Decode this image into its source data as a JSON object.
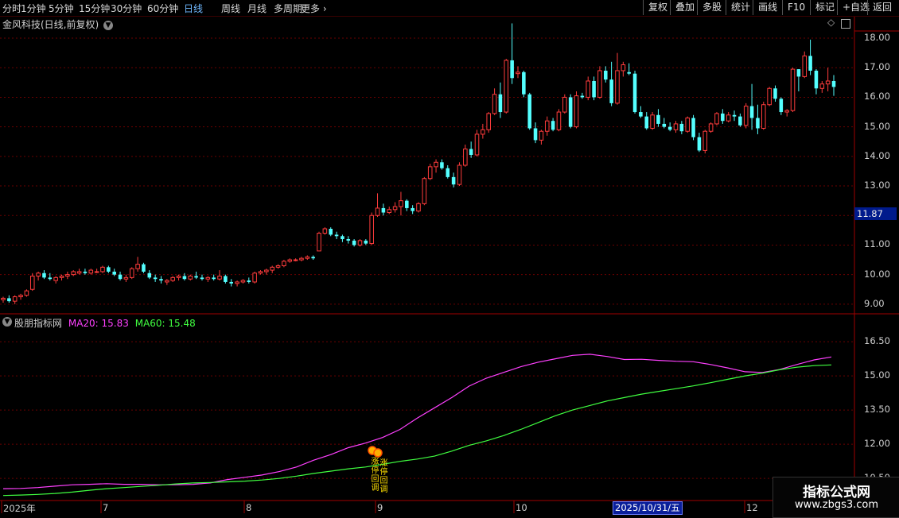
{
  "toolbar": {
    "left_items": [
      "分时",
      "1分钟",
      "5分钟",
      "15分钟",
      "30分钟",
      "60分钟",
      "日线",
      "周线",
      "月线",
      "多周期",
      "更多"
    ],
    "active_item": "日线",
    "right_items": [
      "复权",
      "叠加",
      "多股",
      "统计",
      "画线",
      "F10",
      "+自选",
      "返回"
    ],
    "right_extra": "标记"
  },
  "stock": {
    "title": "金风科技(日线,前复权)"
  },
  "price_axis": {
    "ticks": [
      "18.00",
      "17.00",
      "16.00",
      "15.00",
      "14.00",
      "13.00",
      "12.00",
      "11.00",
      "10.00",
      "9.00"
    ],
    "current_price": "11.87"
  },
  "indicator": {
    "name": "股朋指标网",
    "ma20_label": "MA20: 15.83",
    "ma60_label": "MA60: 15.48",
    "axis_ticks": [
      "16.50",
      "15.00",
      "13.50",
      "12.00",
      "10.50"
    ],
    "signal_text_left": "涨停回调",
    "signal_text_right": "涨停回调"
  },
  "date_axis": {
    "labels": [
      "2025年",
      "7",
      "8",
      "9",
      "10",
      "12"
    ],
    "cursor_date": "2025/10/31/五"
  },
  "watermark": {
    "title": "指标公式网",
    "url": "www.zbgs3.com"
  },
  "colors": {
    "up": "#ff3c3c",
    "down": "#54ffff",
    "ma20": "#ff40ff",
    "ma60": "#40ff40",
    "grid": "#6a0000",
    "signal": "#ffe000"
  },
  "chart_data": {
    "type": "candlestick",
    "price_unit": "CNY",
    "candles": [
      [
        9.15,
        9.25,
        9.05,
        9.2
      ],
      [
        9.2,
        9.3,
        9.05,
        9.1
      ],
      [
        9.1,
        9.3,
        9.0,
        9.25
      ],
      [
        9.25,
        9.35,
        9.15,
        9.3
      ],
      [
        9.3,
        9.5,
        9.25,
        9.45
      ],
      [
        9.5,
        10.05,
        9.45,
        9.95
      ],
      [
        9.95,
        10.1,
        9.8,
        10.05
      ],
      [
        10.05,
        10.15,
        9.85,
        9.9
      ],
      [
        9.9,
        10.05,
        9.8,
        9.85
      ],
      [
        9.8,
        9.95,
        9.7,
        9.9
      ],
      [
        9.9,
        10.0,
        9.8,
        9.95
      ],
      [
        9.95,
        10.1,
        9.85,
        10.0
      ],
      [
        10.0,
        10.15,
        9.95,
        10.1
      ],
      [
        10.05,
        10.2,
        10.0,
        10.1
      ],
      [
        10.1,
        10.2,
        10.0,
        10.05
      ],
      [
        10.05,
        10.2,
        10.0,
        10.15
      ],
      [
        10.1,
        10.2,
        10.05,
        10.1
      ],
      [
        10.1,
        10.3,
        10.05,
        10.25
      ],
      [
        10.25,
        10.3,
        10.05,
        10.1
      ],
      [
        10.1,
        10.2,
        9.95,
        10.0
      ],
      [
        10.0,
        10.1,
        9.8,
        9.85
      ],
      [
        9.85,
        10.0,
        9.75,
        9.9
      ],
      [
        9.9,
        10.25,
        9.85,
        10.2
      ],
      [
        10.2,
        10.6,
        10.1,
        10.35
      ],
      [
        10.35,
        10.4,
        10.05,
        10.1
      ],
      [
        10.05,
        10.15,
        9.85,
        9.9
      ],
      [
        9.9,
        10.0,
        9.75,
        9.85
      ],
      [
        9.85,
        9.95,
        9.7,
        9.8
      ],
      [
        9.75,
        9.85,
        9.65,
        9.8
      ],
      [
        9.8,
        9.95,
        9.75,
        9.9
      ],
      [
        9.9,
        10.0,
        9.8,
        9.95
      ],
      [
        9.95,
        10.05,
        9.8,
        9.85
      ],
      [
        9.85,
        10.0,
        9.8,
        9.95
      ],
      [
        9.95,
        10.1,
        9.85,
        9.9
      ],
      [
        9.9,
        10.0,
        9.8,
        9.85
      ],
      [
        9.85,
        9.95,
        9.75,
        9.9
      ],
      [
        9.9,
        10.0,
        9.8,
        9.85
      ],
      [
        9.85,
        10.15,
        9.8,
        9.95
      ],
      [
        9.95,
        10.0,
        9.7,
        9.75
      ],
      [
        9.75,
        9.85,
        9.6,
        9.7
      ],
      [
        9.7,
        9.8,
        9.6,
        9.75
      ],
      [
        9.75,
        9.85,
        9.7,
        9.8
      ],
      [
        9.8,
        9.9,
        9.7,
        9.75
      ],
      [
        9.75,
        10.1,
        9.7,
        10.05
      ],
      [
        10.05,
        10.15,
        10.0,
        10.1
      ],
      [
        10.1,
        10.2,
        10.0,
        10.15
      ],
      [
        10.15,
        10.3,
        10.05,
        10.25
      ],
      [
        10.25,
        10.35,
        10.2,
        10.3
      ],
      [
        10.3,
        10.5,
        10.25,
        10.45
      ],
      [
        10.45,
        10.55,
        10.4,
        10.5
      ],
      [
        10.5,
        10.55,
        10.45,
        10.5
      ],
      [
        10.5,
        10.6,
        10.45,
        10.55
      ],
      [
        10.55,
        10.65,
        10.5,
        10.6
      ],
      [
        10.6,
        10.65,
        10.5,
        10.55
      ],
      [
        10.8,
        11.45,
        10.8,
        11.4
      ],
      [
        11.4,
        11.6,
        11.35,
        11.55
      ],
      [
        11.55,
        11.6,
        11.3,
        11.35
      ],
      [
        11.35,
        11.45,
        11.2,
        11.3
      ],
      [
        11.3,
        11.35,
        11.1,
        11.2
      ],
      [
        11.2,
        11.3,
        11.05,
        11.15
      ],
      [
        11.15,
        11.2,
        10.95,
        11.0
      ],
      [
        11.0,
        11.2,
        10.95,
        11.15
      ],
      [
        11.15,
        11.2,
        11.0,
        11.05
      ],
      [
        11.05,
        12.1,
        11.0,
        12.0
      ],
      [
        12.0,
        12.75,
        11.95,
        12.25
      ],
      [
        12.25,
        12.4,
        12.0,
        12.1
      ],
      [
        12.1,
        12.3,
        12.05,
        12.2
      ],
      [
        12.2,
        12.45,
        12.1,
        12.3
      ],
      [
        12.3,
        12.8,
        12.0,
        12.5
      ],
      [
        12.5,
        12.55,
        12.15,
        12.25
      ],
      [
        12.25,
        12.35,
        12.05,
        12.15
      ],
      [
        12.15,
        12.45,
        12.1,
        12.4
      ],
      [
        12.4,
        13.3,
        12.35,
        13.25
      ],
      [
        13.25,
        13.75,
        13.2,
        13.65
      ],
      [
        13.65,
        13.9,
        13.45,
        13.8
      ],
      [
        13.8,
        13.9,
        13.55,
        13.6
      ],
      [
        13.6,
        13.7,
        13.25,
        13.3
      ],
      [
        13.3,
        13.45,
        12.95,
        13.05
      ],
      [
        13.05,
        13.8,
        13.0,
        13.7
      ],
      [
        13.7,
        14.4,
        13.65,
        14.25
      ],
      [
        14.25,
        14.5,
        13.95,
        14.05
      ],
      [
        14.05,
        14.9,
        14.0,
        14.75
      ],
      [
        14.75,
        15.1,
        14.6,
        14.9
      ],
      [
        14.9,
        15.5,
        14.8,
        15.45
      ],
      [
        15.45,
        16.3,
        15.4,
        16.1
      ],
      [
        16.1,
        16.5,
        15.3,
        15.5
      ],
      [
        15.5,
        17.3,
        15.45,
        17.25
      ],
      [
        17.25,
        18.5,
        16.45,
        16.65
      ],
      [
        16.8,
        17.05,
        16.65,
        16.85
      ],
      [
        16.85,
        16.9,
        16.0,
        16.1
      ],
      [
        16.1,
        16.15,
        14.9,
        14.95
      ],
      [
        14.95,
        15.15,
        14.45,
        14.55
      ],
      [
        14.55,
        14.9,
        14.4,
        14.85
      ],
      [
        14.85,
        15.35,
        14.7,
        15.2
      ],
      [
        15.2,
        15.3,
        14.85,
        14.9
      ],
      [
        14.9,
        15.6,
        14.85,
        15.5
      ],
      [
        15.5,
        16.1,
        15.45,
        16.0
      ],
      [
        16.0,
        16.1,
        14.95,
        15.0
      ],
      [
        15.0,
        16.2,
        14.95,
        16.05
      ],
      [
        16.05,
        16.15,
        15.95,
        16.0
      ],
      [
        16.0,
        16.7,
        15.9,
        16.55
      ],
      [
        16.55,
        16.7,
        15.9,
        16.0
      ],
      [
        16.0,
        17.05,
        15.95,
        16.9
      ],
      [
        16.9,
        17.05,
        16.5,
        16.6
      ],
      [
        16.6,
        17.2,
        15.7,
        15.8
      ],
      [
        15.8,
        17.5,
        15.75,
        16.9
      ],
      [
        16.9,
        17.2,
        16.7,
        17.1
      ],
      [
        16.85,
        17.15,
        16.75,
        16.8
      ],
      [
        16.8,
        16.9,
        15.45,
        15.5
      ],
      [
        15.5,
        15.7,
        15.3,
        15.35
      ],
      [
        15.35,
        15.5,
        14.9,
        14.95
      ],
      [
        14.95,
        15.5,
        14.9,
        15.4
      ],
      [
        15.4,
        15.6,
        15.0,
        15.1
      ],
      [
        15.1,
        15.3,
        14.95,
        15.0
      ],
      [
        15.0,
        15.15,
        14.85,
        14.9
      ],
      [
        14.9,
        15.2,
        14.8,
        15.1
      ],
      [
        15.1,
        15.2,
        14.75,
        14.85
      ],
      [
        14.85,
        15.35,
        14.8,
        15.3
      ],
      [
        15.3,
        15.4,
        14.55,
        14.65
      ],
      [
        14.65,
        14.8,
        14.15,
        14.2
      ],
      [
        14.2,
        14.9,
        14.1,
        14.85
      ],
      [
        14.85,
        15.15,
        14.8,
        15.1
      ],
      [
        15.1,
        15.5,
        15.05,
        15.45
      ],
      [
        15.45,
        15.6,
        15.1,
        15.2
      ],
      [
        15.2,
        15.5,
        15.15,
        15.4
      ],
      [
        15.4,
        15.55,
        15.2,
        15.35
      ],
      [
        15.35,
        15.45,
        15.0,
        15.05
      ],
      [
        15.05,
        15.8,
        14.95,
        15.7
      ],
      [
        15.7,
        16.45,
        14.9,
        15.3
      ],
      [
        15.3,
        15.75,
        14.75,
        14.95
      ],
      [
        14.95,
        15.85,
        14.9,
        15.75
      ],
      [
        15.75,
        16.35,
        15.7,
        16.3
      ],
      [
        16.3,
        16.4,
        15.85,
        15.95
      ],
      [
        15.95,
        16.0,
        15.4,
        15.5
      ],
      [
        15.5,
        15.6,
        15.35,
        15.55
      ],
      [
        15.55,
        17.0,
        15.5,
        16.95
      ],
      [
        16.95,
        16.95,
        16.2,
        16.7
      ],
      [
        16.7,
        17.55,
        16.65,
        17.4
      ],
      [
        17.4,
        17.95,
        16.75,
        16.9
      ],
      [
        16.9,
        16.95,
        16.1,
        16.3
      ],
      [
        16.3,
        16.55,
        16.15,
        16.45
      ],
      [
        16.45,
        17.0,
        16.2,
        16.55
      ],
      [
        16.55,
        16.75,
        16.05,
        16.35
      ]
    ],
    "ma20": [
      10.05,
      10.06,
      10.1,
      10.16,
      10.22,
      10.24,
      10.27,
      10.24,
      10.24,
      10.22,
      10.22,
      10.24,
      10.3,
      10.45,
      10.55,
      10.65,
      10.8,
      11.0,
      11.3,
      11.55,
      11.85,
      12.05,
      12.3,
      12.65,
      13.15,
      13.6,
      14.05,
      14.55,
      14.9,
      15.15,
      15.4,
      15.6,
      15.75,
      15.9,
      15.95,
      15.85,
      15.72,
      15.73,
      15.68,
      15.64,
      15.62,
      15.5,
      15.35,
      15.18,
      15.15,
      15.28,
      15.5,
      15.7,
      15.83
    ],
    "ma60": [
      9.75,
      9.77,
      9.8,
      9.84,
      9.9,
      9.98,
      10.05,
      10.1,
      10.15,
      10.2,
      10.26,
      10.3,
      10.32,
      10.35,
      10.38,
      10.43,
      10.5,
      10.6,
      10.72,
      10.82,
      10.92,
      11.0,
      11.12,
      11.25,
      11.35,
      11.48,
      11.7,
      11.95,
      12.15,
      12.38,
      12.65,
      12.95,
      13.25,
      13.5,
      13.7,
      13.9,
      14.05,
      14.2,
      14.32,
      14.44,
      14.56,
      14.7,
      14.85,
      15.0,
      15.12,
      15.27,
      15.38,
      15.45,
      15.48
    ],
    "price_ylim": [
      8.7,
      18.7
    ],
    "indicator_ylim": [
      9.6,
      17.2
    ]
  }
}
